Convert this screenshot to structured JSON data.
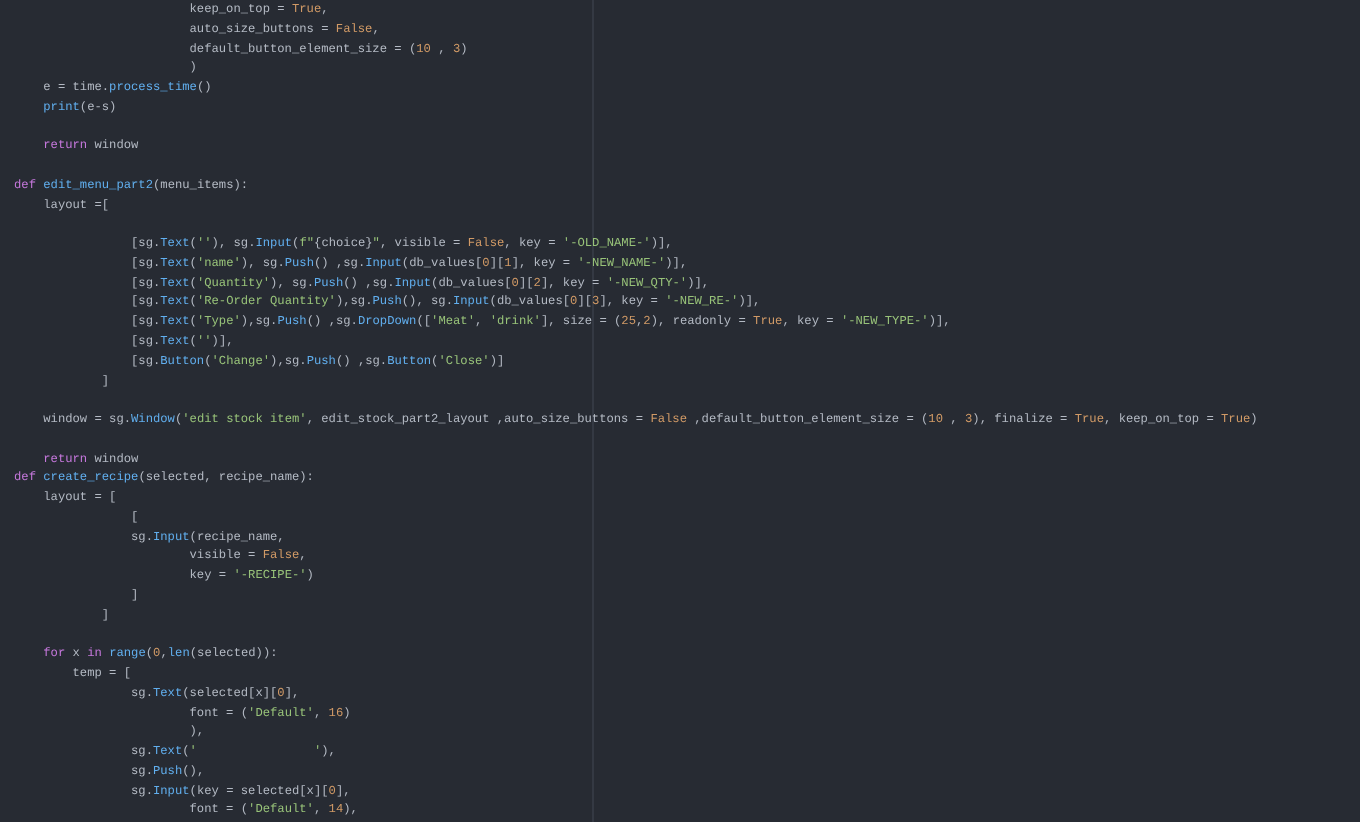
{
  "editor": {
    "blocks": [
      {
        "lines": [
          {
            "tokens": [
              {
                "text": "                        keep_on_top = ",
                "kind": "plain"
              },
              {
                "text": "True",
                "kind": "literal"
              },
              {
                "text": ",",
                "kind": "plain"
              }
            ]
          },
          {
            "tokens": [
              {
                "text": "                        auto_size_buttons = ",
                "kind": "plain"
              },
              {
                "text": "False",
                "kind": "literal"
              },
              {
                "text": ",",
                "kind": "plain"
              }
            ]
          },
          {
            "tokens": [
              {
                "text": "                        default_button_element_size = (",
                "kind": "plain"
              },
              {
                "text": "10",
                "kind": "literal"
              },
              {
                "text": " , ",
                "kind": "plain"
              },
              {
                "text": "3",
                "kind": "literal"
              },
              {
                "text": ")",
                "kind": "plain"
              }
            ]
          },
          {
            "tokens": [
              {
                "text": "                        )",
                "kind": "plain"
              }
            ]
          },
          {
            "tokens": [
              {
                "text": "    e = time.",
                "kind": "plain"
              },
              {
                "text": "process_time",
                "kind": "function"
              },
              {
                "text": "()",
                "kind": "plain"
              }
            ]
          },
          {
            "tokens": [
              {
                "text": "    print",
                "kind": "function"
              },
              {
                "text": "(e-s)",
                "kind": "plain"
              }
            ]
          }
        ]
      },
      {
        "lines": [
          {
            "tokens": [
              {
                "text": "    return",
                "kind": "keyword"
              },
              {
                "text": " window",
                "kind": "plain"
              }
            ]
          }
        ]
      },
      {
        "lines": [
          {
            "tokens": [
              {
                "text": "def ",
                "kind": "keyword"
              },
              {
                "text": "edit_menu_part2",
                "kind": "function"
              },
              {
                "text": "(menu_items):",
                "kind": "plain"
              }
            ]
          },
          {
            "tokens": [
              {
                "text": "    layout =[",
                "kind": "plain"
              }
            ]
          }
        ]
      },
      {
        "lines": [
          {
            "tokens": [
              {
                "text": "                [sg.",
                "kind": "plain"
              },
              {
                "text": "Text",
                "kind": "function"
              },
              {
                "text": "(",
                "kind": "plain"
              },
              {
                "text": "''",
                "kind": "string"
              },
              {
                "text": "), sg.",
                "kind": "plain"
              },
              {
                "text": "Input",
                "kind": "function"
              },
              {
                "text": "(",
                "kind": "plain"
              },
              {
                "text": "f\"",
                "kind": "string"
              },
              {
                "text": "{choice}",
                "kind": "plain"
              },
              {
                "text": "\"",
                "kind": "string"
              },
              {
                "text": ", visible = ",
                "kind": "plain"
              },
              {
                "text": "False",
                "kind": "literal"
              },
              {
                "text": ", key = ",
                "kind": "plain"
              },
              {
                "text": "'-OLD_NAME-'",
                "kind": "string"
              },
              {
                "text": ")],",
                "kind": "plain"
              }
            ]
          },
          {
            "tokens": [
              {
                "text": "                [sg.",
                "kind": "plain"
              },
              {
                "text": "Text",
                "kind": "function"
              },
              {
                "text": "(",
                "kind": "plain"
              },
              {
                "text": "'name'",
                "kind": "string"
              },
              {
                "text": "), sg.",
                "kind": "plain"
              },
              {
                "text": "Push",
                "kind": "function"
              },
              {
                "text": "() ,sg.",
                "kind": "plain"
              },
              {
                "text": "Input",
                "kind": "function"
              },
              {
                "text": "(db_values[",
                "kind": "plain"
              },
              {
                "text": "0",
                "kind": "literal"
              },
              {
                "text": "][",
                "kind": "plain"
              },
              {
                "text": "1",
                "kind": "literal"
              },
              {
                "text": "], key = ",
                "kind": "plain"
              },
              {
                "text": "'-NEW_NAME-'",
                "kind": "string"
              },
              {
                "text": ")],",
                "kind": "plain"
              }
            ]
          },
          {
            "tokens": [
              {
                "text": "                [sg.",
                "kind": "plain"
              },
              {
                "text": "Text",
                "kind": "function"
              },
              {
                "text": "(",
                "kind": "plain"
              },
              {
                "text": "'Quantity'",
                "kind": "string"
              },
              {
                "text": "), sg.",
                "kind": "plain"
              },
              {
                "text": "Push",
                "kind": "function"
              },
              {
                "text": "() ,sg.",
                "kind": "plain"
              },
              {
                "text": "Input",
                "kind": "function"
              },
              {
                "text": "(db_values[",
                "kind": "plain"
              },
              {
                "text": "0",
                "kind": "literal"
              },
              {
                "text": "][",
                "kind": "plain"
              },
              {
                "text": "2",
                "kind": "literal"
              },
              {
                "text": "], key = ",
                "kind": "plain"
              },
              {
                "text": "'-NEW_QTY-'",
                "kind": "string"
              },
              {
                "text": ")],",
                "kind": "plain"
              }
            ]
          },
          {
            "tokens": [
              {
                "text": "                [sg.",
                "kind": "plain"
              },
              {
                "text": "Text",
                "kind": "function"
              },
              {
                "text": "(",
                "kind": "plain"
              },
              {
                "text": "'Re-Order Quantity'",
                "kind": "string"
              },
              {
                "text": "),sg.",
                "kind": "plain"
              },
              {
                "text": "Push",
                "kind": "function"
              },
              {
                "text": "(), sg.",
                "kind": "plain"
              },
              {
                "text": "Input",
                "kind": "function"
              },
              {
                "text": "(db_values[",
                "kind": "plain"
              },
              {
                "text": "0",
                "kind": "literal"
              },
              {
                "text": "][",
                "kind": "plain"
              },
              {
                "text": "3",
                "kind": "literal"
              },
              {
                "text": "], key = ",
                "kind": "plain"
              },
              {
                "text": "'-NEW_RE-'",
                "kind": "string"
              },
              {
                "text": ")],",
                "kind": "plain"
              }
            ]
          },
          {
            "tokens": [
              {
                "text": "                [sg.",
                "kind": "plain"
              },
              {
                "text": "Text",
                "kind": "function"
              },
              {
                "text": "(",
                "kind": "plain"
              },
              {
                "text": "'Type'",
                "kind": "string"
              },
              {
                "text": "),sg.",
                "kind": "plain"
              },
              {
                "text": "Push",
                "kind": "function"
              },
              {
                "text": "() ,sg.",
                "kind": "plain"
              },
              {
                "text": "DropDown",
                "kind": "function"
              },
              {
                "text": "([",
                "kind": "plain"
              },
              {
                "text": "'Meat'",
                "kind": "string"
              },
              {
                "text": ", ",
                "kind": "plain"
              },
              {
                "text": "'drink'",
                "kind": "string"
              },
              {
                "text": "], size = (",
                "kind": "plain"
              },
              {
                "text": "25",
                "kind": "literal"
              },
              {
                "text": ",",
                "kind": "plain"
              },
              {
                "text": "2",
                "kind": "literal"
              },
              {
                "text": "), readonly = ",
                "kind": "plain"
              },
              {
                "text": "True",
                "kind": "literal"
              },
              {
                "text": ", key = ",
                "kind": "plain"
              },
              {
                "text": "'-NEW_TYPE-'",
                "kind": "string"
              },
              {
                "text": ")],",
                "kind": "plain"
              }
            ]
          },
          {
            "tokens": [
              {
                "text": "                [sg.",
                "kind": "plain"
              },
              {
                "text": "Text",
                "kind": "function"
              },
              {
                "text": "(",
                "kind": "plain"
              },
              {
                "text": "''",
                "kind": "string"
              },
              {
                "text": ")],",
                "kind": "plain"
              }
            ]
          },
          {
            "tokens": [
              {
                "text": "                [sg.",
                "kind": "plain"
              },
              {
                "text": "Button",
                "kind": "function"
              },
              {
                "text": "(",
                "kind": "plain"
              },
              {
                "text": "'Change'",
                "kind": "string"
              },
              {
                "text": "),sg.",
                "kind": "plain"
              },
              {
                "text": "Push",
                "kind": "function"
              },
              {
                "text": "() ,sg.",
                "kind": "plain"
              },
              {
                "text": "Button",
                "kind": "function"
              },
              {
                "text": "(",
                "kind": "plain"
              },
              {
                "text": "'Close'",
                "kind": "string"
              },
              {
                "text": ")]",
                "kind": "plain"
              }
            ]
          },
          {
            "tokens": [
              {
                "text": "            ]",
                "kind": "plain"
              }
            ]
          }
        ]
      },
      {
        "lines": [
          {
            "tokens": [
              {
                "text": "    window = sg.",
                "kind": "plain"
              },
              {
                "text": "Window",
                "kind": "function"
              },
              {
                "text": "(",
                "kind": "plain"
              },
              {
                "text": "'edit stock item'",
                "kind": "string"
              },
              {
                "text": ", edit_stock_part2_layout ,auto_size_buttons = ",
                "kind": "plain"
              },
              {
                "text": "False",
                "kind": "literal"
              },
              {
                "text": " ,default_button_element_size = (",
                "kind": "plain"
              },
              {
                "text": "10",
                "kind": "literal"
              },
              {
                "text": " , ",
                "kind": "plain"
              },
              {
                "text": "3",
                "kind": "literal"
              },
              {
                "text": "), finalize = ",
                "kind": "plain"
              },
              {
                "text": "True",
                "kind": "literal"
              },
              {
                "text": ", keep_on_top = ",
                "kind": "plain"
              },
              {
                "text": "True",
                "kind": "literal"
              },
              {
                "text": ")",
                "kind": "plain"
              }
            ]
          }
        ]
      },
      {
        "lines": [
          {
            "tokens": [
              {
                "text": "    return",
                "kind": "keyword"
              },
              {
                "text": " window",
                "kind": "plain"
              }
            ]
          },
          {
            "tokens": [
              {
                "text": "def ",
                "kind": "keyword"
              },
              {
                "text": "create_recipe",
                "kind": "function"
              },
              {
                "text": "(selected, recipe_name):",
                "kind": "plain"
              }
            ]
          },
          {
            "tokens": [
              {
                "text": "    layout = [",
                "kind": "plain"
              }
            ]
          },
          {
            "tokens": [
              {
                "text": "                [",
                "kind": "plain"
              }
            ]
          },
          {
            "tokens": [
              {
                "text": "                sg.",
                "kind": "plain"
              },
              {
                "text": "Input",
                "kind": "function"
              },
              {
                "text": "(recipe_name,",
                "kind": "plain"
              }
            ]
          },
          {
            "tokens": [
              {
                "text": "                        visible = ",
                "kind": "plain"
              },
              {
                "text": "False",
                "kind": "literal"
              },
              {
                "text": ",",
                "kind": "plain"
              }
            ]
          },
          {
            "tokens": [
              {
                "text": "                        key = ",
                "kind": "plain"
              },
              {
                "text": "'-RECIPE-'",
                "kind": "string"
              },
              {
                "text": ")",
                "kind": "plain"
              }
            ]
          },
          {
            "tokens": [
              {
                "text": "                ]",
                "kind": "plain"
              }
            ]
          },
          {
            "tokens": [
              {
                "text": "            ]",
                "kind": "plain"
              }
            ]
          }
        ]
      },
      {
        "lines": [
          {
            "tokens": [
              {
                "text": "    for",
                "kind": "keyword"
              },
              {
                "text": " x ",
                "kind": "plain"
              },
              {
                "text": "in ",
                "kind": "keyword"
              },
              {
                "text": "range",
                "kind": "function"
              },
              {
                "text": "(",
                "kind": "plain"
              },
              {
                "text": "0",
                "kind": "literal"
              },
              {
                "text": ",",
                "kind": "plain"
              },
              {
                "text": "len",
                "kind": "function"
              },
              {
                "text": "(selected)):",
                "kind": "plain"
              }
            ]
          },
          {
            "tokens": [
              {
                "text": "        temp = [",
                "kind": "plain"
              }
            ]
          },
          {
            "tokens": [
              {
                "text": "                sg.",
                "kind": "plain"
              },
              {
                "text": "Text",
                "kind": "function"
              },
              {
                "text": "(selected[x][",
                "kind": "plain"
              },
              {
                "text": "0",
                "kind": "literal"
              },
              {
                "text": "],",
                "kind": "plain"
              }
            ]
          },
          {
            "tokens": [
              {
                "text": "                        font = (",
                "kind": "plain"
              },
              {
                "text": "'Default'",
                "kind": "string"
              },
              {
                "text": ", ",
                "kind": "plain"
              },
              {
                "text": "16",
                "kind": "literal"
              },
              {
                "text": ")",
                "kind": "plain"
              }
            ]
          },
          {
            "tokens": [
              {
                "text": "                        ),",
                "kind": "plain"
              }
            ]
          },
          {
            "tokens": [
              {
                "text": "                sg.",
                "kind": "plain"
              },
              {
                "text": "Text",
                "kind": "function"
              },
              {
                "text": "(",
                "kind": "plain"
              },
              {
                "text": "'                '",
                "kind": "string"
              },
              {
                "text": "),",
                "kind": "plain"
              }
            ]
          },
          {
            "tokens": [
              {
                "text": "                sg.",
                "kind": "plain"
              },
              {
                "text": "Push",
                "kind": "function"
              },
              {
                "text": "(),",
                "kind": "plain"
              }
            ]
          },
          {
            "tokens": [
              {
                "text": "                sg.",
                "kind": "plain"
              },
              {
                "text": "Input",
                "kind": "function"
              },
              {
                "text": "(key = selected[x][",
                "kind": "plain"
              },
              {
                "text": "0",
                "kind": "literal"
              },
              {
                "text": "],",
                "kind": "plain"
              }
            ]
          },
          {
            "tokens": [
              {
                "text": "                        font = (",
                "kind": "plain"
              },
              {
                "text": "'Default'",
                "kind": "string"
              },
              {
                "text": ", ",
                "kind": "plain"
              },
              {
                "text": "14",
                "kind": "literal"
              },
              {
                "text": "),",
                "kind": "plain"
              }
            ]
          }
        ]
      }
    ]
  }
}
